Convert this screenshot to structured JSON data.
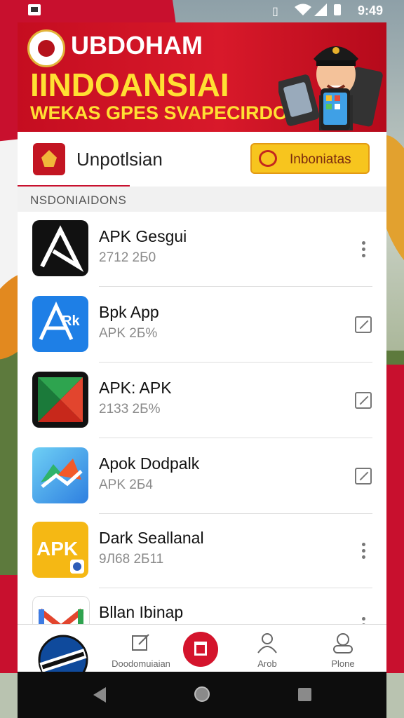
{
  "status_bar": {
    "time": "9:49"
  },
  "banner": {
    "line1": "UBDOHAM",
    "line2": "IINDOANSIAI",
    "line3": "WEKAS GPES SVAPECIRDOM"
  },
  "header": {
    "brand": "Unpotlsian",
    "button_label": "Inboniatas"
  },
  "section_title": "NSDONIAIDONS",
  "apps": [
    {
      "name": "APK Gesgui",
      "meta": "2712 2Б0",
      "icon": "apk-black-logo-icon",
      "action": "more-vert-icon"
    },
    {
      "name": "Bpk App",
      "meta": "APK 2Б%",
      "icon": "apk-blue-logo-icon",
      "action": "edit-icon"
    },
    {
      "name": "APK: APK",
      "meta": "2133 2Б%",
      "icon": "play-store-like-icon",
      "action": "edit-icon"
    },
    {
      "name": "Apok Dodpalk",
      "meta": "APK 2Б4",
      "icon": "colorful-arrow-icon",
      "action": "edit-icon"
    },
    {
      "name": "Dark Seallanal",
      "meta": "9Л68 2Б11",
      "icon": "apk-yellow-logo-icon",
      "action": "more-vert-icon"
    },
    {
      "name": "Bllan Ibinap",
      "meta": "",
      "icon": "gmail-like-icon",
      "action": "more-vert-icon"
    }
  ],
  "bottom_nav": [
    {
      "label": "",
      "icon": "emblem-icon"
    },
    {
      "label": "Doodomuiaian",
      "icon": "edit-square-icon"
    },
    {
      "label": "",
      "icon": "red-fab-icon"
    },
    {
      "label": "Arob",
      "icon": "person-icon"
    },
    {
      "label": "Plone",
      "icon": "profile-icon"
    }
  ],
  "colors": {
    "brand_red": "#c8102e",
    "accent_yellow": "#f7c51e"
  }
}
